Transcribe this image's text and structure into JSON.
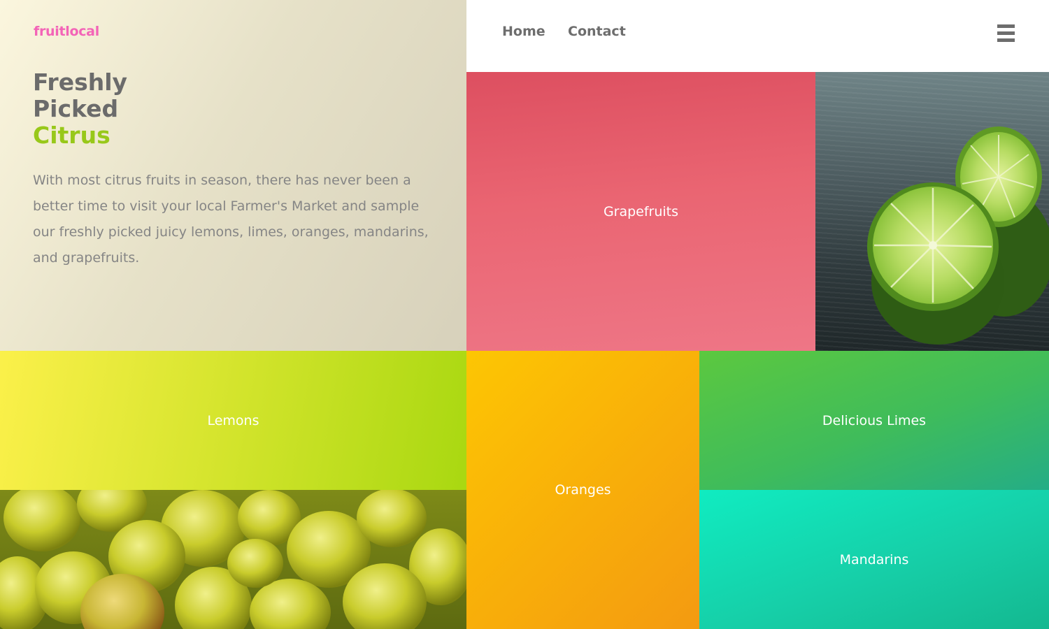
{
  "brand": {
    "logo": "fruitlocal"
  },
  "hero": {
    "headline_line1": "Freshly",
    "headline_line2": "Picked",
    "headline_accent": "Citrus",
    "intro": "With most citrus fruits in season, there has never been a better time to visit your local Farmer's Market and sample our freshly picked juicy lemons, limes, oranges, mandarins, and grapefruits."
  },
  "nav": {
    "items": [
      {
        "label": "Home"
      },
      {
        "label": "Contact"
      }
    ],
    "menu_icon": "hamburger-menu-icon"
  },
  "tiles": {
    "grapefruits": "Grapefruits",
    "lemons": "Lemons",
    "oranges": "Oranges",
    "limes": "Delicious Limes",
    "mandarins": "Mandarins"
  },
  "photos": {
    "limes_photo": "lime-halves-photo",
    "plums_photo": "green-plums-photo"
  },
  "colors": {
    "logo": "#f364b7",
    "accent": "#98c81a",
    "text": "#6b6b6b",
    "grapefruit": "#ea6572",
    "lemon": "#d3e42c",
    "orange": "#f9b208",
    "lime": "#3fbc5b",
    "mandarin": "#16cfa8"
  }
}
